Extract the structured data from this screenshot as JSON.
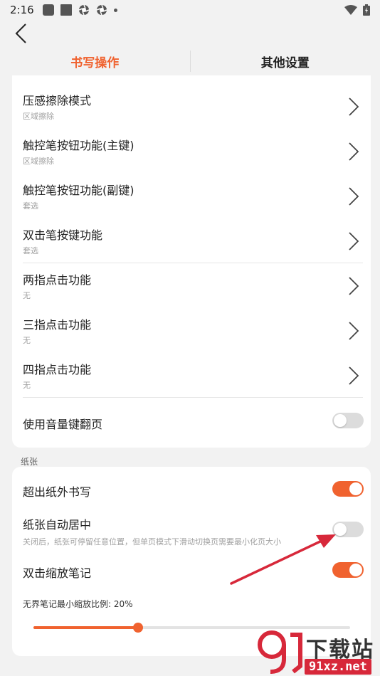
{
  "status": {
    "time": "2:16"
  },
  "tabs": [
    {
      "label": "书写操作",
      "active": true
    },
    {
      "label": "其他设置",
      "active": false
    }
  ],
  "writing_items": [
    {
      "title": "压感擦除模式",
      "value": "区域擦除"
    },
    {
      "title": "触控笔按钮功能(主键)",
      "value": "区域擦除"
    },
    {
      "title": "触控笔按钮功能(副键)",
      "value": "套选"
    },
    {
      "title": "双击笔按键功能",
      "value": "套选"
    },
    {
      "title": "两指点击功能",
      "value": "无"
    },
    {
      "title": "三指点击功能",
      "value": "无"
    },
    {
      "title": "四指点击功能",
      "value": "无"
    }
  ],
  "volume_page_turn": {
    "label": "使用音量键翻页",
    "on": false
  },
  "paper": {
    "section_label": "纸张",
    "write_outside": {
      "label": "超出纸外书写",
      "on": true
    },
    "auto_center": {
      "label": "纸张自动居中",
      "description": "关闭后，纸张可停留任意位置，但单页模式下滑动切换页需要最小化页大小",
      "on": false
    },
    "double_tap_zoom": {
      "label": "双击缩放笔记",
      "on": true
    },
    "min_zoom": {
      "label": "无界笔记最小缩放比例: 20%",
      "fraction": 0.33
    }
  },
  "watermark": {
    "brand": "下载站",
    "site": "91xz.net",
    "logo_text": "91"
  },
  "colors": {
    "accent": "#f0622f",
    "background": "#f2f2f2",
    "card": "#ffffff",
    "annotation_arrow": "#d7283a"
  }
}
